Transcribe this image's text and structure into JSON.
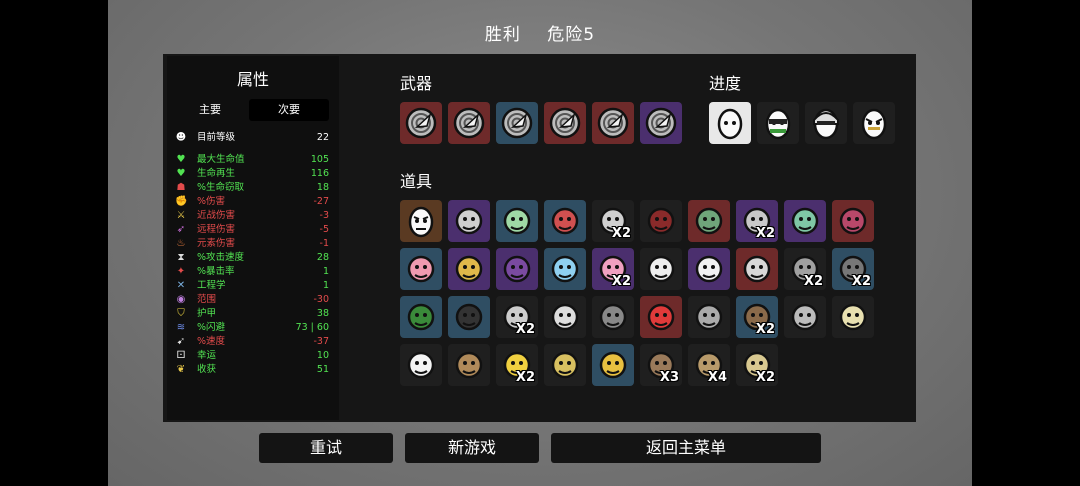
{
  "header": {
    "result": "胜利",
    "danger": "危险5"
  },
  "stats": {
    "title": "属性",
    "tabs": {
      "primary": "主要",
      "secondary": "次要"
    },
    "rows": [
      {
        "icon": "level-icon",
        "label": "目前等级",
        "value": "22",
        "color": "#ffffff"
      },
      {
        "icon": "heart-icon",
        "label": "最大生命值",
        "value": "105",
        "color": "#52e352"
      },
      {
        "icon": "heart-plus-icon",
        "label": "生命再生",
        "value": "116",
        "color": "#52e352"
      },
      {
        "icon": "fang-icon",
        "label": "%生命窃取",
        "value": "18",
        "color": "#52e352"
      },
      {
        "icon": "fist-icon",
        "label": "%伤害",
        "value": "-27",
        "color": "#e34b4b"
      },
      {
        "icon": "sword-icon",
        "label": "近战伤害",
        "value": "-3",
        "color": "#e34b4b"
      },
      {
        "icon": "bow-icon",
        "label": "远程伤害",
        "value": "-5",
        "color": "#e34b4b"
      },
      {
        "icon": "flame-icon",
        "label": "元素伤害",
        "value": "-1",
        "color": "#e34b4b"
      },
      {
        "icon": "hourglass-icon",
        "label": "%攻击速度",
        "value": "28",
        "color": "#52e352"
      },
      {
        "icon": "crit-icon",
        "label": "%暴击率",
        "value": "1",
        "color": "#52e352"
      },
      {
        "icon": "wrench-icon",
        "label": "工程学",
        "value": "1",
        "color": "#52e352"
      },
      {
        "icon": "range-icon",
        "label": "范围",
        "value": "-30",
        "color": "#e34b4b"
      },
      {
        "icon": "shield-icon",
        "label": "护甲",
        "value": "38",
        "color": "#52e352"
      },
      {
        "icon": "dodge-icon",
        "label": "%闪避",
        "value": "73 | 60",
        "color": "#52e352"
      },
      {
        "icon": "boot-icon",
        "label": "%速度",
        "value": "-37",
        "color": "#e34b4b"
      },
      {
        "icon": "dice-icon",
        "label": "幸运",
        "value": "10",
        "color": "#52e352"
      },
      {
        "icon": "harvest-icon",
        "label": "收获",
        "value": "51",
        "color": "#52e352"
      }
    ]
  },
  "weapons": {
    "title": "武器",
    "items": [
      {
        "name": "spiral-shell-weapon-icon",
        "tier": "red"
      },
      {
        "name": "spiral-shell-weapon-icon",
        "tier": "red"
      },
      {
        "name": "spiral-shell-weapon-icon",
        "tier": "blue"
      },
      {
        "name": "spiral-shell-weapon-icon",
        "tier": "red"
      },
      {
        "name": "spiral-shell-weapon-icon",
        "tier": "red"
      },
      {
        "name": "spiral-shell-weapon-icon",
        "tier": "purple"
      }
    ]
  },
  "progress": {
    "title": "进度",
    "items": [
      {
        "name": "egg-character-icon",
        "tier": "white"
      },
      {
        "name": "egg-sunglasses-icon",
        "tier": "dark"
      },
      {
        "name": "egg-helmet-icon",
        "tier": "dark"
      },
      {
        "name": "egg-angry-icon",
        "tier": "dark"
      }
    ]
  },
  "items": {
    "title": "道具",
    "rows": [
      [
        {
          "name": "egg-face-item-icon",
          "tier": "brown",
          "qty": ""
        },
        {
          "name": "robot-item-icon",
          "tier": "purple",
          "qty": ""
        },
        {
          "name": "medic-robot-item-icon",
          "tier": "blue",
          "qty": ""
        },
        {
          "name": "claw-item-icon",
          "tier": "blue",
          "qty": ""
        },
        {
          "name": "turret-item-icon",
          "tier": "dark",
          "qty": "X2"
        },
        {
          "name": "cloak-item-icon",
          "tier": "dark",
          "qty": ""
        },
        {
          "name": "pod-item-icon",
          "tier": "red",
          "qty": ""
        },
        {
          "name": "bottle-item-icon",
          "tier": "purple",
          "qty": "X2"
        },
        {
          "name": "alien-item-icon",
          "tier": "purple",
          "qty": ""
        },
        {
          "name": "chest-item-icon",
          "tier": "red",
          "qty": ""
        }
      ],
      [
        {
          "name": "pig-item-icon",
          "tier": "blue",
          "qty": ""
        },
        {
          "name": "crown-item-icon",
          "tier": "purple",
          "qty": ""
        },
        {
          "name": "bag-item-icon",
          "tier": "purple",
          "qty": ""
        },
        {
          "name": "butterfly-item-icon",
          "tier": "blue",
          "qty": ""
        },
        {
          "name": "candy-item-icon",
          "tier": "purple",
          "qty": "X2"
        },
        {
          "name": "fang-item-icon",
          "tier": "dark",
          "qty": ""
        },
        {
          "name": "beard-item-icon",
          "tier": "purple",
          "qty": ""
        },
        {
          "name": "compass-item-icon",
          "tier": "red",
          "qty": ""
        },
        {
          "name": "cannon-item-icon",
          "tier": "dark",
          "qty": "X2"
        },
        {
          "name": "horn-item-icon",
          "tier": "blue",
          "qty": "X2"
        }
      ],
      [
        {
          "name": "machine-item-icon",
          "tier": "blue",
          "qty": ""
        },
        {
          "name": "rock-item-icon",
          "tier": "blue",
          "qty": ""
        },
        {
          "name": "scythe-item-icon",
          "tier": "dark",
          "qty": "X2"
        },
        {
          "name": "ghost-item-icon",
          "tier": "dark",
          "qty": ""
        },
        {
          "name": "tiki-item-icon",
          "tier": "dark",
          "qty": ""
        },
        {
          "name": "blood-item-icon",
          "tier": "red",
          "qty": ""
        },
        {
          "name": "helmet-item-icon",
          "tier": "dark",
          "qty": ""
        },
        {
          "name": "boots-item-icon",
          "tier": "blue",
          "qty": "X2"
        },
        {
          "name": "wave-item-icon",
          "tier": "dark",
          "qty": ""
        },
        {
          "name": "lizard-item-icon",
          "tier": "dark",
          "qty": ""
        }
      ],
      [
        {
          "name": "cup-item-icon",
          "tier": "dark",
          "qty": ""
        },
        {
          "name": "monkey-item-icon",
          "tier": "dark",
          "qty": ""
        },
        {
          "name": "bee-item-icon",
          "tier": "dark",
          "qty": "X2"
        },
        {
          "name": "coin-item-icon",
          "tier": "dark",
          "qty": ""
        },
        {
          "name": "necklace-item-icon",
          "tier": "blue",
          "qty": ""
        },
        {
          "name": "pouch-item-icon",
          "tier": "dark",
          "qty": "X3"
        },
        {
          "name": "feather-item-icon",
          "tier": "dark",
          "qty": "X4"
        },
        {
          "name": "map-item-icon",
          "tier": "dark",
          "qty": "X2"
        }
      ]
    ]
  },
  "buttons": {
    "retry": "重试",
    "new_game": "新游戏",
    "main_menu": "返回主菜单"
  },
  "colors": {
    "tier_dark": "#1f1f1f",
    "tier_blue": "#2f4e63",
    "tier_purple": "#4b2f6e",
    "tier_red": "#6e2a2a",
    "tier_white": "#e8e8e8",
    "tier_brown": "#5a3a22",
    "positive": "#52e352",
    "negative": "#e34b4b"
  }
}
